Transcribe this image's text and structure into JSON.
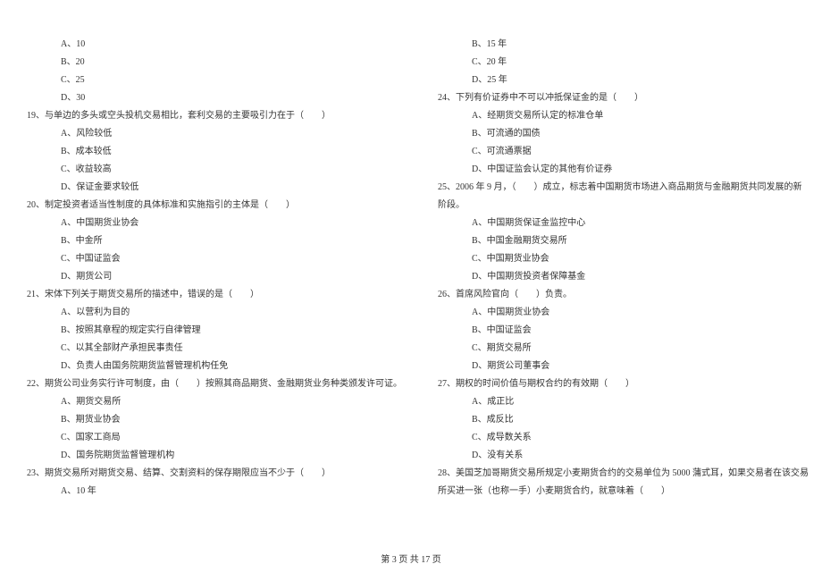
{
  "left": {
    "opts_pre": [
      "A、10",
      "B、20",
      "C、25",
      "D、30"
    ],
    "q19": "19、与单边的多头或空头投机交易相比，套利交易的主要吸引力在于（　　）",
    "q19_opts": [
      "A、风险较低",
      "B、成本较低",
      "C、收益较高",
      "D、保证金要求较低"
    ],
    "q20": "20、制定投资者适当性制度的具体标准和实施指引的主体是（　　）",
    "q20_opts": [
      "A、中国期货业协会",
      "B、中金所",
      "C、中国证监会",
      "D、期货公司"
    ],
    "q21": "21、宋体下列关于期货交易所的描述中，错误的是（　　）",
    "q21_opts": [
      "A、以营利为目的",
      "B、按照其章程的规定实行自律管理",
      "C、以其全部财产承担民事责任",
      "D、负责人由国务院期货监督管理机构任免"
    ],
    "q22": "22、期货公司业务实行许可制度，由（　　）按照其商品期货、金融期货业务种类颁发许可证。",
    "q22_opts": [
      "A、期货交易所",
      "B、期货业协会",
      "C、国家工商局",
      "D、国务院期货监督管理机构"
    ],
    "q23": "23、期货交易所对期货交易、结算、交割资料的保存期限应当不少于（　　）",
    "q23_opts": [
      "A、10 年"
    ]
  },
  "right": {
    "opts_pre": [
      "B、15 年",
      "C、20 年",
      "D、25 年"
    ],
    "q24": "24、下列有价证券中不可以冲抵保证金的是（　　）",
    "q24_opts": [
      "A、经期货交易所认定的标准仓单",
      "B、可流通的国债",
      "C、可流通票据",
      "D、中国证监会认定的其他有价证券"
    ],
    "q25_l1": "25、2006 年 9 月，（　　）成立，标志着中国期货市场进入商品期货与金融期货共同发展的新",
    "q25_l2": "阶段。",
    "q25_opts": [
      "A、中国期货保证金监控中心",
      "B、中国金融期货交易所",
      "C、中国期货业协会",
      "D、中国期货投资者保障基金"
    ],
    "q26": "26、首席风险官向（　　）负责。",
    "q26_opts": [
      "A、中国期货业协会",
      "B、中国证监会",
      "C、期货交易所",
      "D、期货公司董事会"
    ],
    "q27": "27、期权的时间价值与期权合约的有效期（　　）",
    "q27_opts": [
      "A、成正比",
      "B、成反比",
      "C、成导数关系",
      "D、没有关系"
    ],
    "q28_l1": "28、美国芝加哥期货交易所规定小麦期货合约的交易单位为 5000 蒲式耳，如果交易者在该交易",
    "q28_l2": "所买进一张（也称一手）小麦期货合约，就意味着（　　）"
  },
  "footer": "第 3 页 共 17 页"
}
